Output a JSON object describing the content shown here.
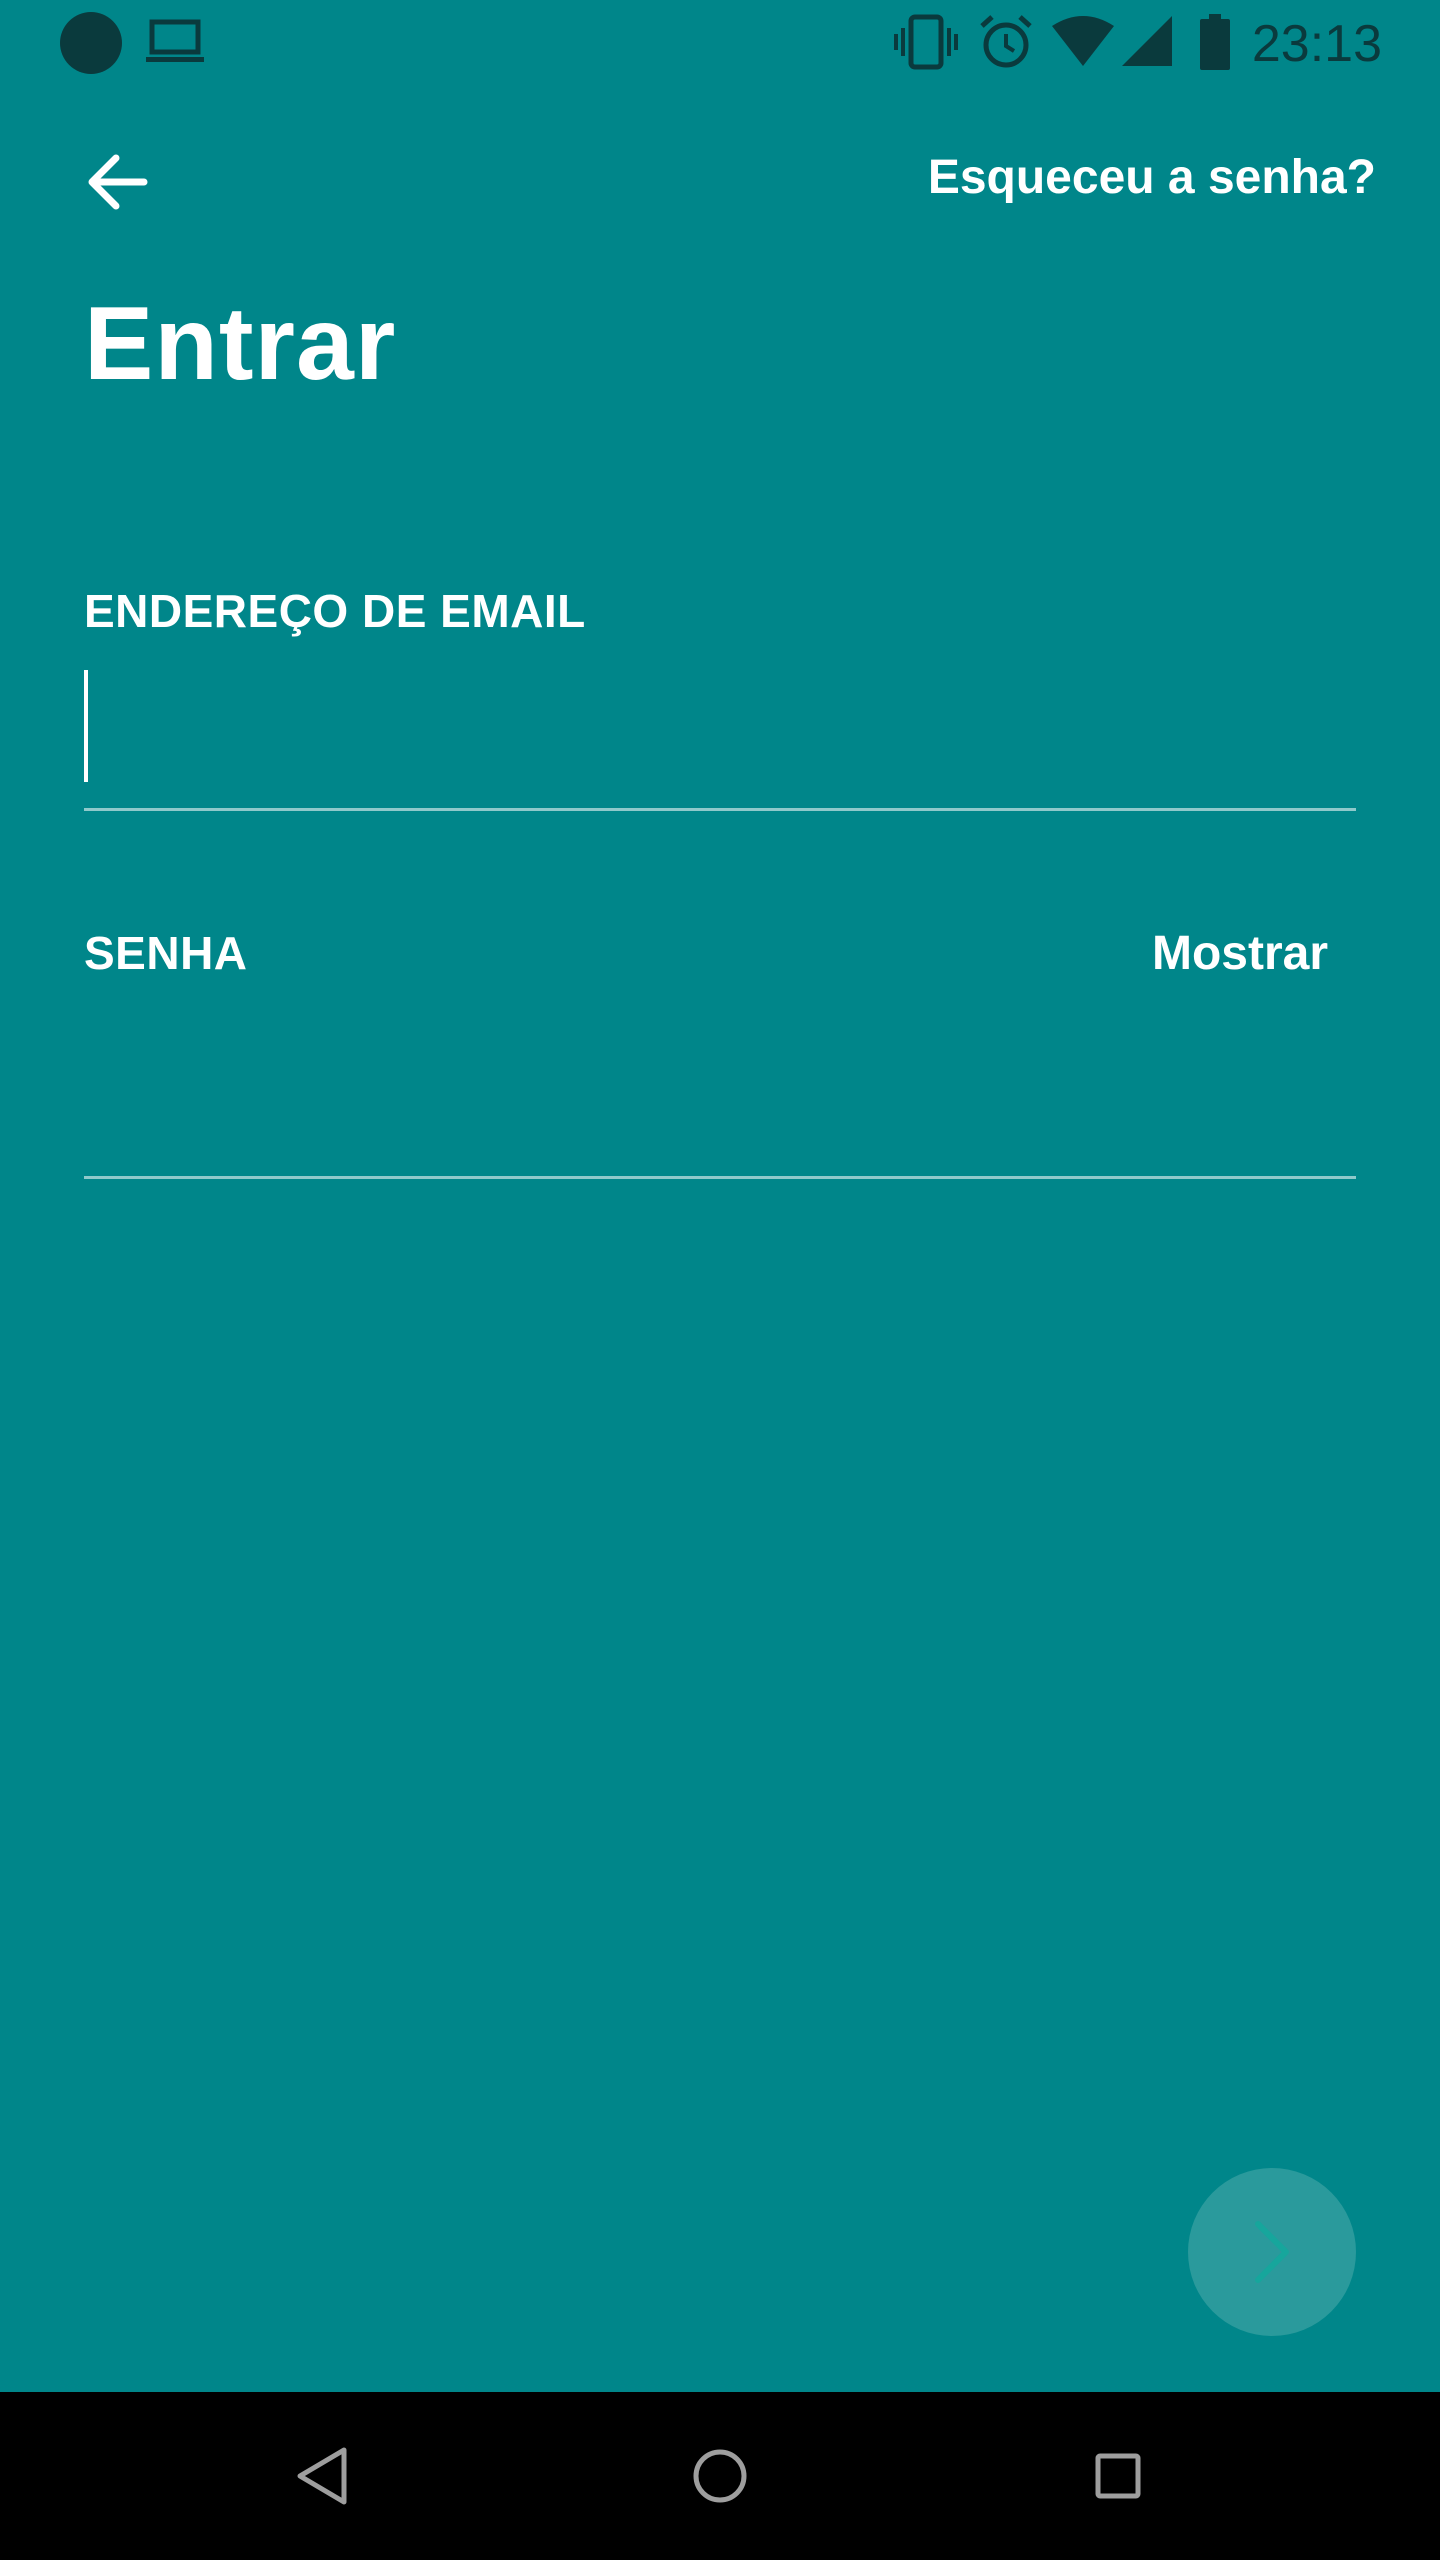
{
  "status_bar": {
    "time": "23:13",
    "icons": [
      "notification-dot-icon",
      "laptop-icon",
      "vibrate-icon",
      "alarm-icon",
      "wifi-icon",
      "signal-icon",
      "battery-icon"
    ]
  },
  "header": {
    "back_icon": "arrow-left-icon",
    "forgot_password": "Esqueceu a senha?"
  },
  "page": {
    "title": "Entrar"
  },
  "form": {
    "email": {
      "label": "ENDEREÇO DE EMAIL",
      "value": "",
      "placeholder": ""
    },
    "password": {
      "label": "SENHA",
      "show_label": "Mostrar",
      "value": "",
      "placeholder": ""
    }
  },
  "next_button": {
    "icon": "chevron-right-icon"
  },
  "nav_bar": {
    "buttons": [
      "back-triangle-icon",
      "home-circle-icon",
      "recents-square-icon"
    ]
  },
  "colors": {
    "background": "#00868A",
    "status_icons": "#0a3a3d",
    "divider": "#8fc9cb",
    "fab": "#2a9a9c",
    "fab_icon": "#16a69c",
    "nav_background": "#000000"
  }
}
